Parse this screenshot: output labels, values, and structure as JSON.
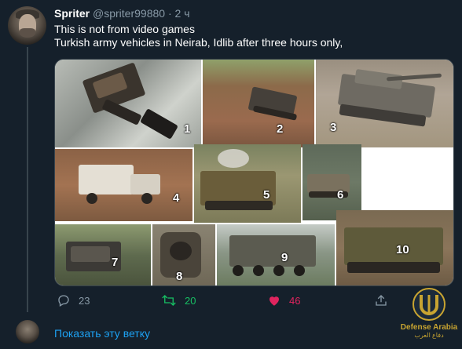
{
  "tweet": {
    "name": "Spriter",
    "handle": "@spriter99880",
    "separator": "·",
    "time": "2 ч",
    "lines": [
      "This is not from video games",
      "Turkish army vehicles in Neirab, Idlib after three hours only,"
    ]
  },
  "media": {
    "panels": [
      {
        "label": "1",
        "scene": "burnt armored vehicle on road"
      },
      {
        "label": "2",
        "scene": "vehicle on dirt"
      },
      {
        "label": "3",
        "scene": "tank in field"
      },
      {
        "label": "4",
        "scene": "white pickup truck"
      },
      {
        "label": "5",
        "scene": "armored vehicle with smoke"
      },
      {
        "label": "6",
        "scene": "armored vehicle"
      },
      {
        "label": "7",
        "scene": "wrecked vehicle"
      },
      {
        "label": "8",
        "scene": "burnt vehicle top view"
      },
      {
        "label": "9",
        "scene": "wheeled armored vehicle"
      },
      {
        "label": "10",
        "scene": "tracked armored vehicle"
      }
    ]
  },
  "actions": {
    "reply_count": "23",
    "retweet_count": "20",
    "like_count": "46",
    "retweet_color": "#17bf63",
    "like_color": "#e0245e",
    "icons": [
      "reply-icon",
      "retweet-icon",
      "heart-icon",
      "share-icon"
    ]
  },
  "watermark": {
    "text": "Defense Arabia",
    "subtext": "دفاع العرب"
  },
  "show_thread": {
    "label": "Показать эту ветку"
  },
  "colors": {
    "background": "#15202b",
    "secondary_text": "#8899a6",
    "link": "#1da1f2",
    "border": "#38444d"
  }
}
